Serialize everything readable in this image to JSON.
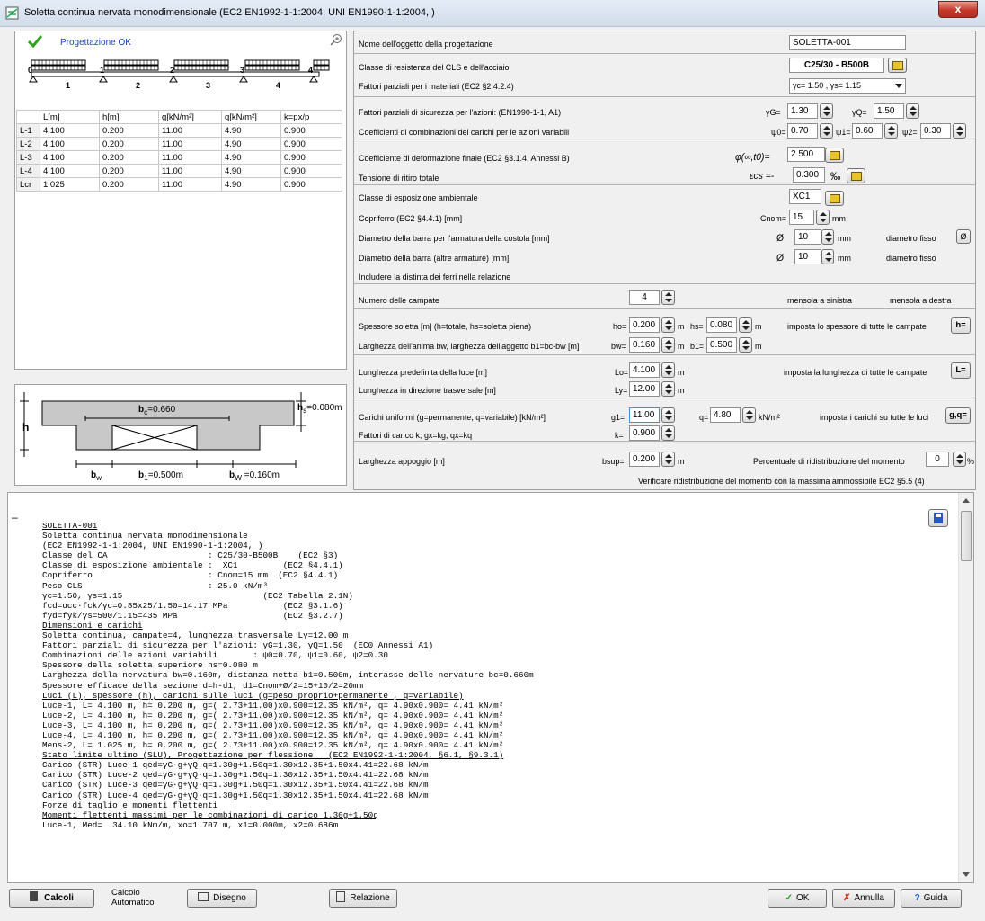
{
  "window": {
    "title": "Soletta continua nervata monodimensionale (EC2 EN1992-1-1:2004, UNI EN1990-1-1:2004, )",
    "close": "x"
  },
  "status": {
    "text": "Progettazione OK"
  },
  "beam": {
    "span_labels": [
      "1",
      "2",
      "3",
      "4"
    ],
    "support_labels": [
      "0",
      "1",
      "2",
      "3",
      "4"
    ]
  },
  "table": {
    "headers": [
      "L[m]",
      "h[m]",
      "g[kN/m²]",
      "q[kN/m²]",
      "k=px/p"
    ],
    "rows": [
      {
        "name": "L-1",
        "cells": [
          "4.100",
          "0.200",
          "11.00",
          "4.90",
          "0.900"
        ]
      },
      {
        "name": "L-2",
        "cells": [
          "4.100",
          "0.200",
          "11.00",
          "4.90",
          "0.900"
        ]
      },
      {
        "name": "L-3",
        "cells": [
          "4.100",
          "0.200",
          "11.00",
          "4.90",
          "0.900"
        ]
      },
      {
        "name": "L-4",
        "cells": [
          "4.100",
          "0.200",
          "11.00",
          "4.90",
          "0.900"
        ]
      },
      {
        "name": "Lcr",
        "cells": [
          "1.025",
          "0.200",
          "11.00",
          "4.90",
          "0.900"
        ]
      }
    ]
  },
  "section": {
    "bc_label": "b",
    "bc_sub": "c",
    "bc_val": "=0.660",
    "hs_label": "h",
    "hs_sub": "s",
    "hs_val": "=0.080m",
    "h": "h",
    "bw": "b",
    "bw_sub": "w",
    "b1": "b",
    "b1_sub": "1",
    "b1_val": "=0.500m",
    "bw2": "b",
    "bw2_sub": "W",
    "bw2_val": " =0.160m"
  },
  "form": {
    "nome_label": "Nome dell'oggetto della progettazione",
    "nome_value": "SOLETTA-001",
    "classe_label": "Classe di resistenza del CLS e dell'acciaio",
    "classe_value": "C25/30 - B500B",
    "fattori_mat_label": "Fattori parziali per i materiali (EC2 §2.4.2.4)",
    "fattori_mat_value": "γc= 1.50 , γs= 1.15",
    "fattori_azioni_label": "Fattori parziali di sicurezza per l'azioni: (EN1990-1-1, A1)",
    "gG_label": "γG=",
    "gG": "1.30",
    "gQ_label": "γQ=",
    "gQ": "1.50",
    "coeff_comb_label": "Coefficienti di combinazioni dei carichi per le azioni variabili",
    "psi0_label": "ψ0=",
    "psi0": "0.70",
    "psi1_label": "ψ1=",
    "psi1": "0.60",
    "psi2_label": "ψ2=",
    "psi2": "0.30",
    "coeff_def_label": "Coefficiente di deformazione finale (EC2 §3.1.4, Annessi B)",
    "phi_label": "φ(∞,t0)=",
    "phi": "2.500",
    "ritiro_label": "Tensione di ritiro totale",
    "ecs_label": "εcs =-",
    "ecs": "0.300",
    "ecs_unit": "‰",
    "esposizione_label": "Classe di esposizione ambientale",
    "esposizione": "XC1",
    "copriferro_label": "Copriferro (EC2 §4.4.1) [mm]",
    "cnom_label": "Cnom=",
    "cnom": "15",
    "cnom_unit": "mm",
    "diam_costola_label": "Diametro della barra per l'armatura della costola [mm]",
    "diam_sym": "Ø",
    "diam_costola": "10",
    "mm": "mm",
    "diam_fisso": "diametro fisso",
    "diam_altre_label": "Diametro della barra (altre armature) [mm]",
    "diam_altre": "10",
    "distinta_label": "Includere la distinta dei ferri nella relazione",
    "campate_label": "Numero delle campate",
    "campate": "4",
    "mensola_sx": "mensola a sinistra",
    "mensola_dx": "mensola a destra",
    "spessore_label": "Spessore soletta [m] (h=totale, hs=soletta piena)",
    "ho_label": "ho=",
    "ho": "0.200",
    "m": "m",
    "hs_label": "hs=",
    "hs": "0.080",
    "imposta_spessore": "imposta lo spessore di tutte le campate",
    "h_btn": "h=",
    "larghezza_label": "Larghezza dell'anima bw, larghezza dell'aggetto b1=bc-bw [m]",
    "bw_label": "bw=",
    "bw": "0.160",
    "b1_label": "b1=",
    "b1": "0.500",
    "luce_label": "Lunghezza predefinita della luce [m]",
    "lo_label": "Lo=",
    "lo": "4.100",
    "imposta_luce": "imposta la lunghezza di tutte le campate",
    "l_btn": "L=",
    "trasv_label": "Lunghezza in direzione trasversale [m]",
    "ly_label": "Ly=",
    "ly": "12.00",
    "carichi_label": "Carichi uniformi (g=permanente, q=variabile) [kN/m²]",
    "g1_label": "g1=",
    "g1": "11.00",
    "q_label": "q=",
    "q": "4.80",
    "kn_unit": "kN/m²",
    "imposta_carichi": "imposta i carichi su tutte le luci",
    "gq_btn": "g,q=",
    "fattori_carico_label": "Fattori di carico k, gx=kg, qx=kq",
    "k_label": "k=",
    "k": "0.900",
    "appoggio_label": "Larghezza appoggio [m]",
    "bsup_label": "bsup=",
    "bsup": "0.200",
    "ridistr_label": "Percentuale di ridistribuzione del momento",
    "ridistr": "0",
    "pct": "%",
    "verifica_label": "Verificare ridistribuzione del momento con la massima ammossibile EC2  §5.5 (4)"
  },
  "report": {
    "lines": [
      "SOLETTA-001",
      "Soletta continua nervata monodimensionale",
      "(EC2 EN1992-1-1:2004, UNI EN1990-1-1:2004, )",
      "Classe del CA                    : C25/30-B500B    (EC2 §3)",
      "Classe di esposizione ambientale :  XC1         (EC2 §4.4.1)",
      "Copriferro                       : Cnom=15 mm  (EC2 §4.4.1)",
      "Peso CLS                         : 25.0 kN/m³",
      "γc=1.50, γs=1.15                            (EC2 Tabella 2.1N)",
      "fcd=αcc·fck/γc=0.85x25/1.50=14.17 MPa           (EC2 §3.1.6)",
      "fyd=fyk/γs=500/1.15=435 MPa                     (EC2 §3.2.7)",
      "Dimensioni e carichi",
      "Soletta continua, campate=4, lunghezza trasversale Ly=12.00 m",
      "Fattori parziali di sicurezza per l'azioni: γG=1.30, γQ=1.50  (EC0 Annessi A1)",
      "Combinazioni delle azioni variabili       : ψ0=0.70, ψ1=0.60, ψ2=0.30",
      "Spessore della soletta superiore hs=0.080 m",
      "Larghezza della nervatura bw=0.160m, distanza netta b1=0.500m, interasse delle nervature bc=0.660m",
      "Spessore efficace della sezione d=h-d1, d1=Cnom+Ø/2=15+10/2=20mm",
      "Luci (L), spessore (h), carichi sulle luci (g=peso proprio+permanente , q=variabile)",
      "Luce-1, L= 4.100 m, h= 0.200 m, g=( 2.73+11.00)x0.900=12.35 kN/m², q= 4.90x0.900= 4.41 kN/m²",
      "Luce-2, L= 4.100 m, h= 0.200 m, g=( 2.73+11.00)x0.900=12.35 kN/m², q= 4.90x0.900= 4.41 kN/m²",
      "Luce-3, L= 4.100 m, h= 0.200 m, g=( 2.73+11.00)x0.900=12.35 kN/m², q= 4.90x0.900= 4.41 kN/m²",
      "Luce-4, L= 4.100 m, h= 0.200 m, g=( 2.73+11.00)x0.900=12.35 kN/m², q= 4.90x0.900= 4.41 kN/m²",
      "Mens-2, L= 1.025 m, h= 0.200 m, g=( 2.73+11.00)x0.900=12.35 kN/m², q= 4.90x0.900= 4.41 kN/m²",
      "Stato limite ultimo (SLU), Progettazione per flessione   (EC2 EN1992-1-1:2004, §6.1, §9.3.1)",
      "Carico (STR) Luce-1 qed=γG·g+γQ·q=1.30g+1.50q=1.30x12.35+1.50x4.41=22.68 kN/m",
      "Carico (STR) Luce-2 qed=γG·g+γQ·q=1.30g+1.50q=1.30x12.35+1.50x4.41=22.68 kN/m",
      "Carico (STR) Luce-3 qed=γG·g+γQ·q=1.30g+1.50q=1.30x12.35+1.50x4.41=22.68 kN/m",
      "Carico (STR) Luce-4 qed=γG·g+γQ·q=1.30g+1.50q=1.30x12.35+1.50x4.41=22.68 kN/m",
      "Forze di taglio e momenti flettenti",
      "Momenti flettenti massimi per le combinazioni di carico 1.30g+1.50q",
      "Luce-1, Med=  34.10 kNm/m, xo=1.707 m, x1=0.000m, x2=0.686m"
    ],
    "underlined": [
      0,
      10,
      11,
      17,
      23,
      28,
      29
    ],
    "minus": "–"
  },
  "bottom": {
    "calcoli": "Calcoli",
    "calcolo_auto_1": "Calcolo",
    "calcolo_auto_2": "Automatico",
    "disegno": "Disegno",
    "relazione": "Relazione",
    "ok": "OK",
    "annulla": "Annulla",
    "guida": "Guida"
  },
  "colors": {
    "check": "#2ca21f",
    "status_text": "#1c3fbf",
    "select_blue": "#3c8ee0",
    "cancel_red": "#d42a1a"
  }
}
